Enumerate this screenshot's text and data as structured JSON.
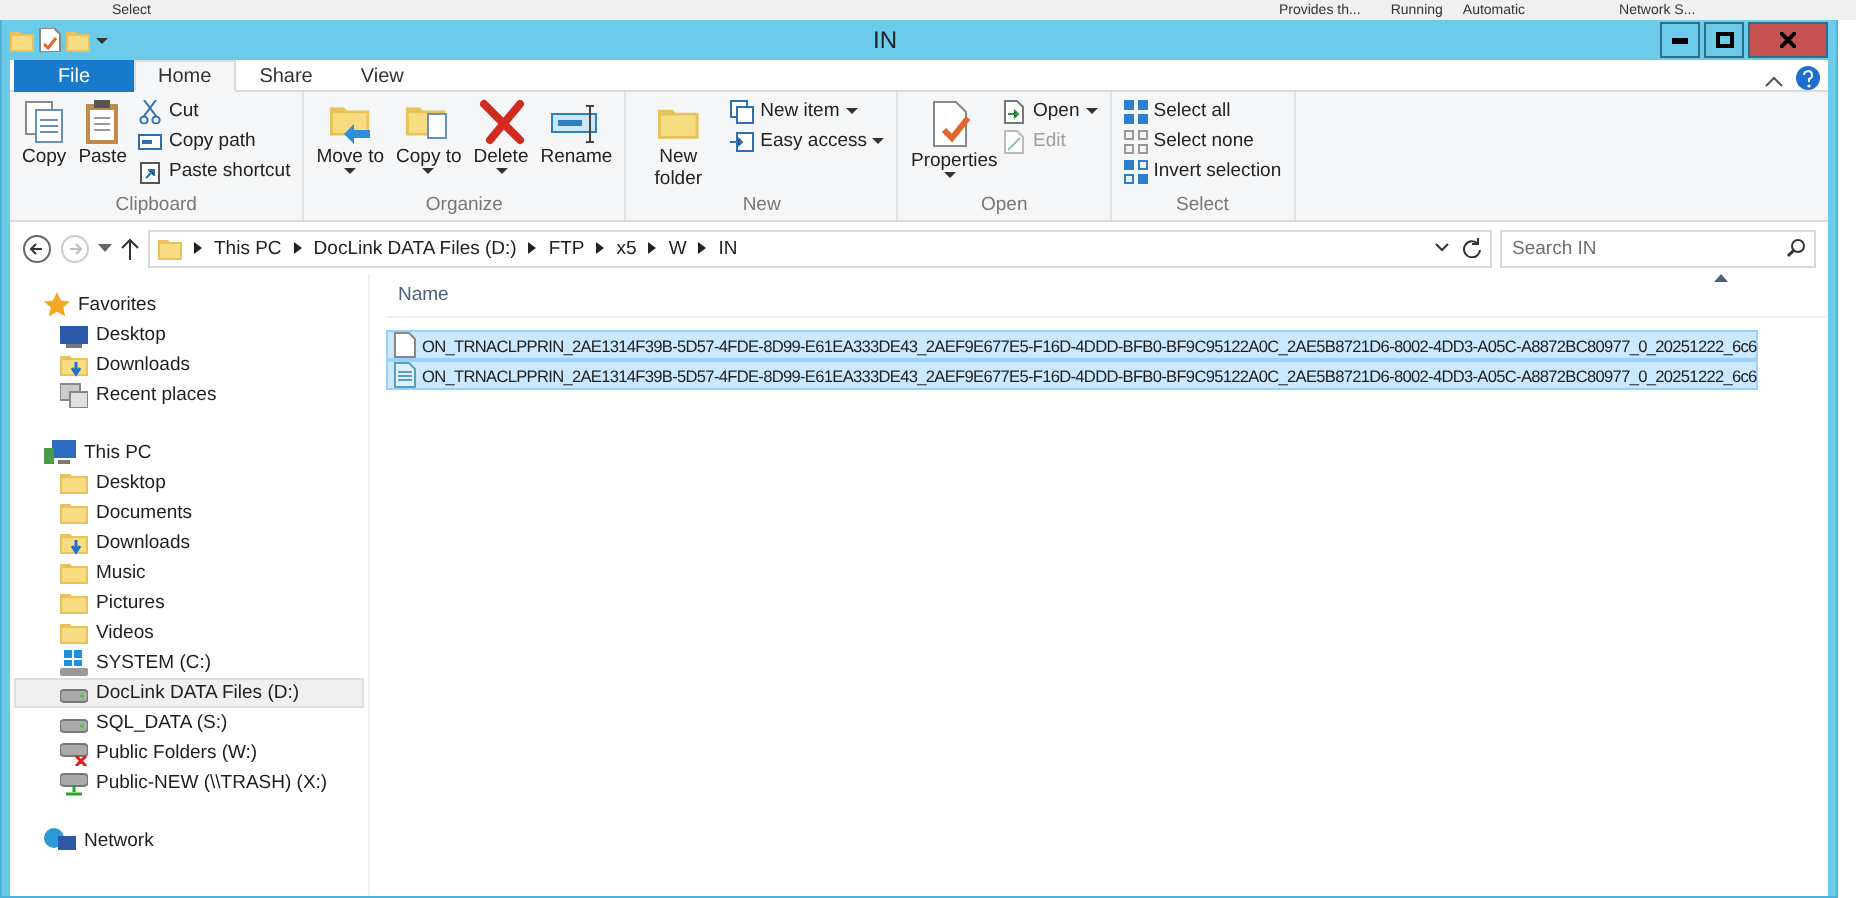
{
  "background_window": {
    "texts": [
      "Select",
      "Provides th...",
      "Running",
      "Automatic",
      "Network S..."
    ]
  },
  "window": {
    "title": "IN"
  },
  "ribbon": {
    "tabs": [
      {
        "label": "File",
        "kind": "file",
        "selected": false
      },
      {
        "label": "Home",
        "kind": "tab",
        "selected": true
      },
      {
        "label": "Share",
        "kind": "tab",
        "selected": false
      },
      {
        "label": "View",
        "kind": "tab",
        "selected": false
      }
    ],
    "groups": [
      {
        "label": "Clipboard",
        "large": [
          {
            "label": "Copy",
            "dropdown": false
          },
          {
            "label": "Paste",
            "dropdown": false
          }
        ],
        "small": [
          {
            "label": "Cut",
            "dropdown": false,
            "disabled": false
          },
          {
            "label": "Copy path",
            "dropdown": false,
            "disabled": false
          },
          {
            "label": "Paste shortcut",
            "dropdown": false,
            "disabled": false
          }
        ]
      },
      {
        "label": "Organize",
        "large": [
          {
            "label": "Move to",
            "dropdown": true
          },
          {
            "label": "Copy to",
            "dropdown": true
          },
          {
            "label": "Delete",
            "dropdown": true
          },
          {
            "label": "Rename",
            "dropdown": false
          }
        ]
      },
      {
        "label": "New",
        "large": [
          {
            "label": "New folder",
            "dropdown": false
          }
        ],
        "small": [
          {
            "label": "New item",
            "dropdown": true,
            "disabled": false
          },
          {
            "label": "Easy access",
            "dropdown": true,
            "disabled": false
          }
        ]
      },
      {
        "label": "Open",
        "large": [
          {
            "label": "Properties",
            "dropdown": true
          }
        ],
        "small": [
          {
            "label": "Open",
            "dropdown": true,
            "disabled": false
          },
          {
            "label": "Edit",
            "dropdown": false,
            "disabled": true
          }
        ]
      },
      {
        "label": "Select",
        "small": [
          {
            "label": "Select all",
            "dropdown": false,
            "disabled": false
          },
          {
            "label": "Select none",
            "dropdown": false,
            "disabled": false
          },
          {
            "label": "Invert selection",
            "dropdown": false,
            "disabled": false
          }
        ]
      }
    ]
  },
  "address": {
    "path": [
      "This PC",
      "DocLink DATA Files (D:)",
      "FTP",
      "x5",
      "W",
      "IN"
    ],
    "search": {
      "placeholder": "Search IN"
    }
  },
  "navigation": [
    {
      "label": "Favorites",
      "selected": false,
      "children": [
        {
          "label": "Desktop",
          "selected": false
        },
        {
          "label": "Downloads",
          "selected": false
        },
        {
          "label": "Recent places",
          "selected": false
        }
      ]
    },
    {
      "label": "This PC",
      "selected": false,
      "children": [
        {
          "label": "Desktop",
          "selected": false
        },
        {
          "label": "Documents",
          "selected": false
        },
        {
          "label": "Downloads",
          "selected": false
        },
        {
          "label": "Music",
          "selected": false
        },
        {
          "label": "Pictures",
          "selected": false
        },
        {
          "label": "Videos",
          "selected": false
        },
        {
          "label": "SYSTEM (C:)",
          "selected": false
        },
        {
          "label": "DocLink DATA Files (D:)",
          "selected": true
        },
        {
          "label": "SQL_DATA (S:)",
          "selected": false
        },
        {
          "label": "Public Folders (W:)",
          "selected": false
        },
        {
          "label": "Public-NEW (\\\\TRASH) (X:)",
          "selected": false
        }
      ]
    },
    {
      "label": "Network",
      "selected": false
    }
  ],
  "files": {
    "columns": [
      "Name"
    ],
    "rows": [
      {
        "name": "ON_TRNACLPPRIN_2AE1314F39B-5D57-4FDE-8D99-E61EA333DE43_2AEF9E677E5-F16D-4DDD-BFB0-BF9C95122A0C_2AE5B8721D6-8002-4DD3-A05C-A8872BC80977_0_20251222_6c6",
        "selected": true
      },
      {
        "name": "ON_TRNACLPPRIN_2AE1314F39B-5D57-4FDE-8D99-E61EA333DE43_2AEF9E677E5-F16D-4DDD-BFB0-BF9C95122A0C_2AE5B8721D6-8002-4DD3-A05C-A8872BC80977_0_20251222_6c6",
        "selected": true
      }
    ]
  }
}
